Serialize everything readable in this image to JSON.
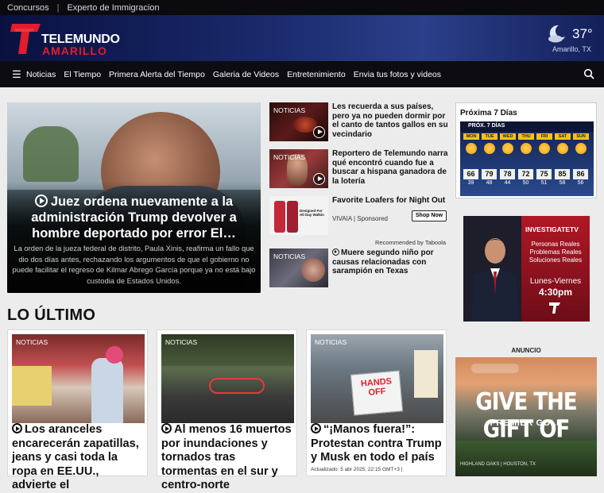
{
  "topbar": {
    "links": [
      "Concursos",
      "Experto de Immigracion"
    ]
  },
  "brand": {
    "wordmark": "TELEMUNDO",
    "city": "AMARILLO"
  },
  "weather": {
    "icon": "moon-cloud-icon",
    "temp": "37°",
    "location": "Amarillo, TX"
  },
  "nav": {
    "menu_icon": "hamburger-icon",
    "items": [
      "Noticias",
      "El Tiempo",
      "Primera Alerta del Tiempo",
      "Galeria de Videos",
      "Entretenimiento",
      "Envia tus fotos y videos"
    ],
    "search_icon": "search-icon"
  },
  "hero": {
    "title": "Juez ordena nuevamente a la administración Trump devolver a hombre deportado por error El…",
    "description": "La orden de la jueza federal de distrito, Paula Xinis, reafirma un fallo que dio dos días antes, rechazando los argumentos de que el gobierno no puede facilitar el regreso de Kilmar Abrego García porque ya no está bajo custodia de Estados Unidos."
  },
  "side_stories": [
    {
      "label": "NOTICIAS",
      "text": "Les recuerda a sus países, pero ya no pueden dormir por el canto de tantos gallos en su vecindario"
    },
    {
      "label": "NOTICIAS",
      "text": "Reportero de Telemundo narra qué encontró cuando fue a buscar a hispana ganadora de la lotería"
    }
  ],
  "ad_story": {
    "title": "Favorite Loafers for Night Out",
    "brand": "VIVAIA | Sponsored",
    "button": "Shop Now",
    "thumb_text": "Designed For All Day Walkin"
  },
  "taboola": "Recommended by Taboola",
  "side_story_3": {
    "label": "NOTICIAS",
    "text": "Muere segundo niño por causas relacionadas con sarampión en Texas"
  },
  "weather_widget": {
    "title": "Próxima 7 Días",
    "banner": "PRÓX. 7 DÍAS",
    "days": [
      "MON",
      "TUE",
      "WED",
      "THU",
      "FRI",
      "SAT",
      "SUN"
    ],
    "highs": [
      "66",
      "79",
      "78",
      "72",
      "75",
      "85",
      "86"
    ],
    "lows": [
      "39",
      "48",
      "44",
      "50",
      "51",
      "58",
      "56"
    ]
  },
  "promo": {
    "brand": "INVESTIGATETV",
    "lines": [
      "Personas Reales",
      "Problemas Reales",
      "Soluciones Reales"
    ],
    "days": "Lunes-Viernes",
    "time": "4:30pm"
  },
  "section": {
    "title": "LO ÚLTIMO"
  },
  "anuncio": "ANUNCIO",
  "golf_ad": {
    "line1": "GIVE THE GIFT OF",
    "line2": "PREMIER GOLF",
    "footer": "HIGHLAND OAKS | HOUSTON, TX"
  },
  "latest": [
    {
      "label": "NOTICIAS",
      "title": "Los aranceles encarecerán zapatillas, jeans y casi toda la ropa en EE.UU., advierte el"
    },
    {
      "label": "NOTICIAS",
      "title": "Al menos 16 muertos por inundaciones y tornados tras tormentas en el sur y centro-norte"
    },
    {
      "label": "NOTICIAS",
      "title": "“¡Manos fuera!”: Protestan contra Trump y Musk en todo el país",
      "time": "Actualizado: 5 abr 2025, 22:15 GMT+3  |"
    }
  ],
  "colors": {
    "accent": "#e21d2d",
    "navy": "#1a2a6c",
    "nav_bg": "#0c0c12"
  }
}
